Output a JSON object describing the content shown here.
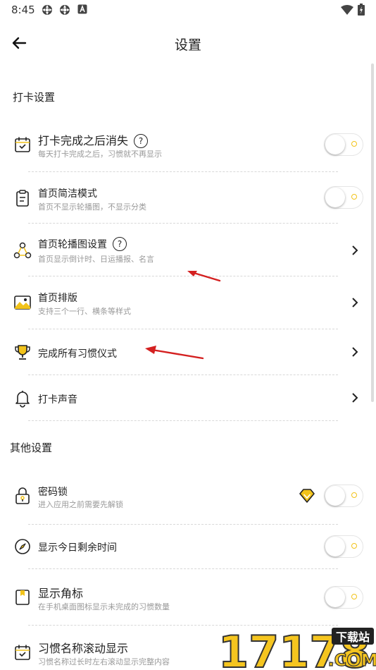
{
  "status_bar": {
    "time": "8:45"
  },
  "header": {
    "title": "设置"
  },
  "sections": {
    "checkin": "打卡设置",
    "other": "其他设置"
  },
  "rows": {
    "disappear": {
      "label": "打卡完成之后消失",
      "sub": "每天打卡完成之后，习惯就不再显示",
      "help": "?"
    },
    "simple": {
      "label": "首页简洁模式",
      "sub": "首页不显示轮播图，不显示分类"
    },
    "carousel": {
      "label": "首页轮播图设置",
      "sub": "首页显示倒计时、日运播报、名言",
      "help": "?"
    },
    "layout": {
      "label": "首页排版",
      "sub": "支持三个一行、横条等样式"
    },
    "ritual": {
      "label": "完成所有习惯仪式"
    },
    "sound": {
      "label": "打卡声音"
    },
    "lock": {
      "label": "密码锁",
      "sub": "进入应用之前需要先解锁"
    },
    "remaining": {
      "label": "显示今日剩余时间"
    },
    "badge": {
      "label": "显示角标",
      "sub": "在手机桌面图标显示未完成的习惯数量"
    },
    "scroll": {
      "label": "习惯名称滚动显示",
      "sub": "习惯名称过长时左右滚动显示完整内容"
    }
  },
  "toggles": {
    "disappear": false,
    "simple": false,
    "lock": false,
    "remaining": false,
    "badge": false,
    "scroll": false
  },
  "watermark": {
    "digits": "17178",
    "tag": "下载站",
    "domain": ".COM"
  },
  "colors": {
    "accent": "#f2c31a",
    "annotation_arrow": "#d42020"
  }
}
